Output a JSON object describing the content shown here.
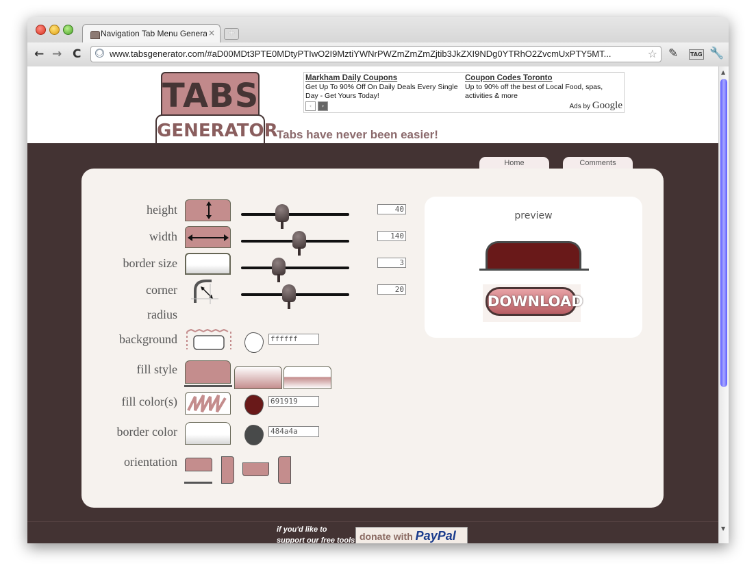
{
  "browser": {
    "tab_title": "Navigation Tab Menu Genera",
    "tab_close": "×",
    "new_tab": "+",
    "url": "www.tabsgenerator.com/#aD00MDt3PTE0MDtyPTIwO2I9MztiYWNrPWZmZmZmZjtib3JkZXI9NDg0YTRhO2ZvcmUxPTY5MT...",
    "back_icon": "←",
    "forward_icon": "→",
    "reload_icon": "C",
    "star_icon": "☆",
    "ext_icon": "✎",
    "tag_icon": "TAG",
    "wrench_icon": "🔧"
  },
  "header": {
    "logo_top": "TABS",
    "logo_bottom": "GENERATOR",
    "tagline": "Tabs have never been easier!"
  },
  "ads": {
    "items": [
      {
        "title": "Markham Daily Coupons",
        "text": "Get Up To 90% Off On Daily Deals Every Single Day - Get Yours Today!"
      },
      {
        "title": "Coupon Codes Toronto",
        "text": "Up to 90% off the best of Local Food, spas, activities & more"
      }
    ],
    "prev": "‹",
    "next": "›",
    "ads_by": "Ads by",
    "google": "Google"
  },
  "nav": {
    "home": "Home",
    "comments": "Comments"
  },
  "controls": {
    "height": {
      "label": "height",
      "value": "40",
      "slider_fraction": 0.38
    },
    "width": {
      "label": "width",
      "value": "140",
      "slider_fraction": 0.54
    },
    "border_size": {
      "label": "border size",
      "value": "3",
      "slider_fraction": 0.35
    },
    "corner": {
      "label": "corner",
      "label2": "radius",
      "value": "20",
      "slider_fraction": 0.44
    },
    "background": {
      "label": "background",
      "color": "ffffff"
    },
    "fill_style": {
      "label": "fill style"
    },
    "fill_color": {
      "label": "fill color(s)",
      "color": "691919"
    },
    "border_color": {
      "label": "border color",
      "color": "484a4a"
    },
    "orientation": {
      "label": "orientation"
    }
  },
  "preview": {
    "label": "preview",
    "download": "DOWNLOAD"
  },
  "footer": {
    "donate_line1": "if you'd like to",
    "donate_line2": "support our free tools",
    "donate_with": "donate with",
    "paypal": "PayPal"
  },
  "colors": {
    "accent": "#c48d8d",
    "dark_bg": "#433333",
    "fill": "#691919",
    "border": "#484a4a"
  }
}
